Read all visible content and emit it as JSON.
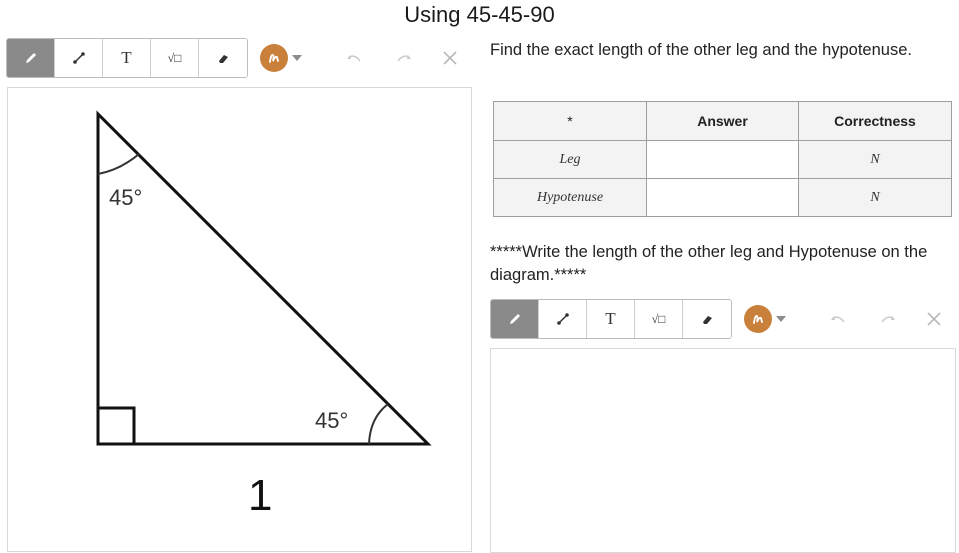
{
  "title": "Using 45-45-90",
  "toolbar": {
    "tools": [
      {
        "name": "pencil-tool",
        "icon": "pencil-icon",
        "label": ""
      },
      {
        "name": "line-tool",
        "icon": "line-icon",
        "label": ""
      },
      {
        "name": "text-tool",
        "icon": "text-icon",
        "label": "T"
      },
      {
        "name": "sqrt-tool",
        "icon": "sqrt-icon",
        "label": "√□"
      },
      {
        "name": "eraser-tool",
        "icon": "eraser-icon",
        "label": ""
      }
    ],
    "color": "#c8803a",
    "undo_icon": "undo-icon",
    "redo_icon": "redo-icon",
    "clear_icon": "close-icon"
  },
  "diagram": {
    "top_angle": "45°",
    "bottom_angle": "45°",
    "leg_label": "1"
  },
  "question": "Find the exact length of the other leg and the hypotenuse.",
  "table": {
    "headers": [
      "*",
      "Answer",
      "Correctness"
    ],
    "rows": [
      {
        "label": "Leg",
        "answer": "",
        "correctness": "N"
      },
      {
        "label": "Hypotenuse",
        "answer": "",
        "correctness": "N"
      }
    ]
  },
  "note": "*****Write the length of the other leg and Hypotenuse on the diagram.*****"
}
